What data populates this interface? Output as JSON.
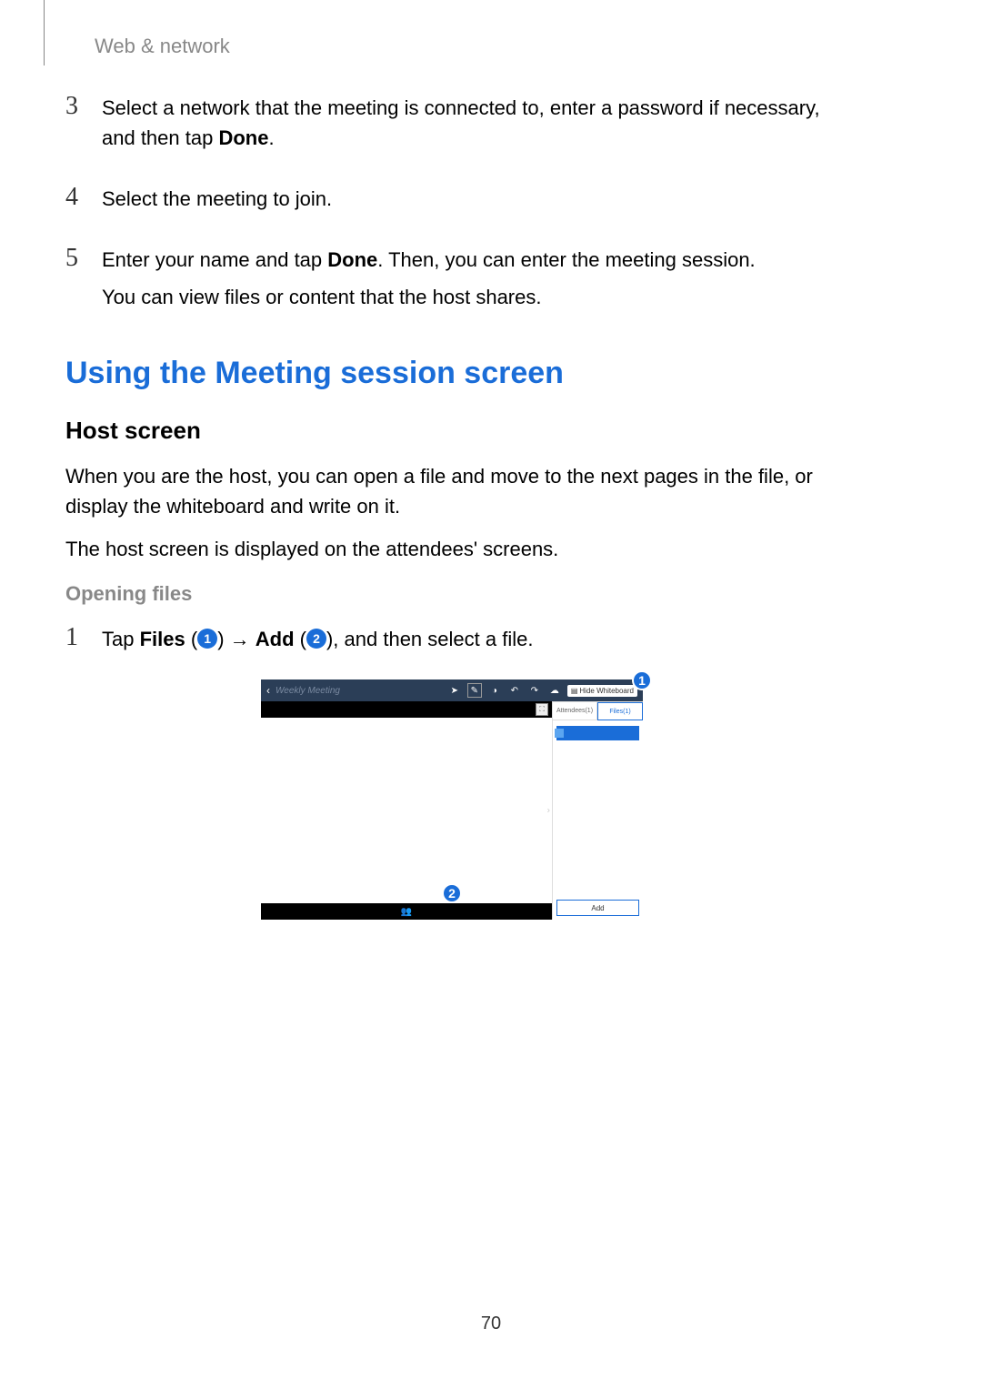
{
  "page": {
    "header": "Web & network",
    "number": "70"
  },
  "steps": {
    "s3": {
      "num": "3",
      "text1": "Select a network that the meeting is connected to, enter a password if necessary, and then tap ",
      "done": "Done",
      "text2": "."
    },
    "s4": {
      "num": "4",
      "text": "Select the meeting to join."
    },
    "s5": {
      "num": "5",
      "text1": "Enter your name and tap ",
      "done": "Done",
      "text2": ". Then, you can enter the meeting session.",
      "p2": "You can view files or content that the host shares."
    }
  },
  "section": {
    "title": "Using the Meeting session screen",
    "host": {
      "title": "Host screen",
      "p1": "When you are the host, you can open a file and move to the next pages in the file, or display the whiteboard and write on it.",
      "p2": "The host screen is displayed on the attendees' screens."
    },
    "opening": {
      "title": "Opening files",
      "step1": {
        "num": "1",
        "text1": "Tap ",
        "files": "Files",
        "paren1": " (",
        "circ1": "1",
        "paren1c": ") ",
        "arrow": "→ ",
        "add": "Add",
        "paren2": " (",
        "circ2": "2",
        "paren2c": "), and then select a file."
      }
    }
  },
  "screenshot": {
    "meeting_title": "Weekly Meeting",
    "hide_wb": "Hide Whiteboard",
    "attendees_tab": "Attendees(1)",
    "files_tab": "Files(1)",
    "add_btn": "Add",
    "callout1": "1",
    "callout2": "2"
  }
}
